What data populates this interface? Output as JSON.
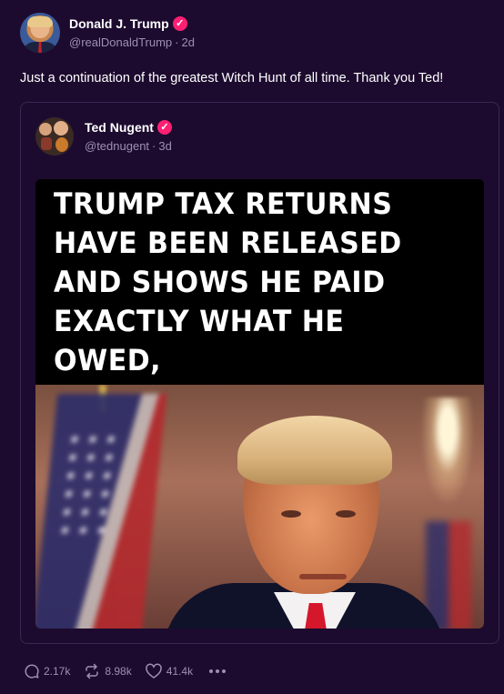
{
  "post": {
    "author": {
      "display_name": "Donald J. Trump",
      "handle": "@realDonaldTrump",
      "age": "2d"
    },
    "text": "Just a continuation of the greatest Witch Hunt of all time. Thank you Ted!",
    "quoted": {
      "author": {
        "display_name": "Ted Nugent",
        "handle": "@tednugent",
        "age": "3d"
      },
      "image_text": "TRUMP TAX RETURNS\nHAVE BEEN RELEASED\nAND SHOWS HE PAID\nEXACTLY WHAT HE OWED,\nNO CRIMES COMMITTED"
    },
    "stats": {
      "replies": "2.17k",
      "reposts": "8.98k",
      "likes": "41.4k"
    }
  },
  "icons": {
    "verified": "verified-badge-icon",
    "reply": "reply-icon",
    "repost": "repost-icon",
    "like": "heart-icon",
    "more": "more-icon"
  },
  "colors": {
    "background": "#1d0b2f",
    "verified_badge": "#ff1f72",
    "muted_text": "#9d8fb3",
    "card_border": "#3a2752"
  }
}
